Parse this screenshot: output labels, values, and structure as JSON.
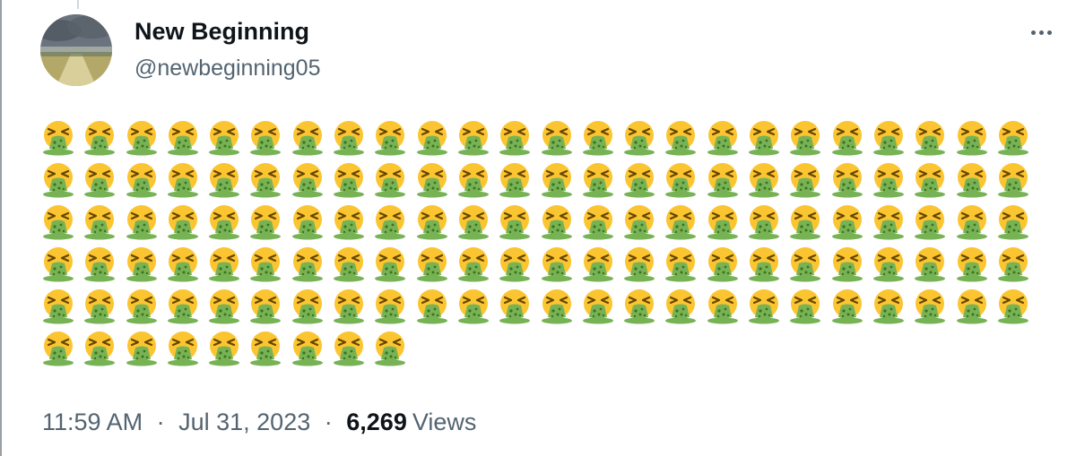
{
  "tweet": {
    "display_name": "New Beginning",
    "handle": "@newbeginning05",
    "emoji_name": "nauseated-vomiting-face",
    "emoji_count": 129,
    "emoji_per_row": 24,
    "timestamp_time": "11:59 AM",
    "timestamp_date": "Jul 31, 2023",
    "separator": "·",
    "views_count": "6,269",
    "views_label": "Views",
    "more_icon": "more-horizontal-icon"
  },
  "colors": {
    "name": "#0f1419",
    "secondary_text": "#536471",
    "emoji_face": "#fbc531",
    "emoji_vomit": "#77b255"
  }
}
